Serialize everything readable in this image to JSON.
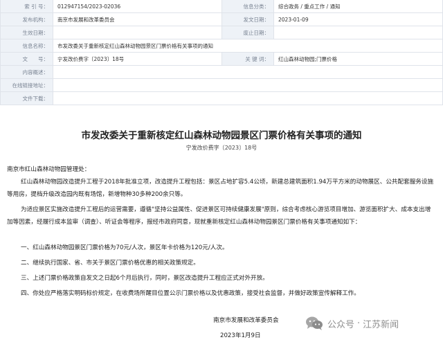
{
  "meta": {
    "rows": [
      {
        "l1": "索 引 号：",
        "v1": "012947154/2023-02036",
        "l2": "信息分类：",
        "v2": "综合政务 / 重点工作 / 通知"
      },
      {
        "l1": "发布机构：",
        "v1": "南京市发展和改革委员会",
        "l2": "发文日期：",
        "v2": "2023-01-09"
      },
      {
        "l1": "生效日期：",
        "v1": "",
        "l2": "废止日期：",
        "v2": ""
      },
      {
        "l1": "信息名称：",
        "v1": "市发改委关于重新核定红山森林动物园景区门票价格有关事项的通知"
      },
      {
        "l1": "文　　号：",
        "v1": "宁发改价费字〔2023〕18号",
        "l2": "关 键 词：",
        "v2": "红山森林动物园;门票价格"
      },
      {
        "l1": "内容概述：",
        "v1": ""
      },
      {
        "l1": "在线链接地址：",
        "v1": ""
      },
      {
        "l1": "文件下载：",
        "v1": ""
      }
    ]
  },
  "doc": {
    "title": "市发改委关于重新核定红山森林动物园景区门票价格有关事项的通知",
    "doc_number": "宁发改价费字〔2023〕18号",
    "salutation": "南京市红山森林动物园管理处：",
    "paragraphs": [
      "红山森林动物园改造提升工程于2018年批准立项，改造提升工程包括：景区占地扩容5.4公顷，新建总建筑面积1.94万平方米的动物展区、公共配套服务设施等用房，提档升级改造园内既有场馆，新增物种30多种200余只等。",
      "为适应景区实施改造提升工程后的运营需要，遵循\"坚持公益属性、促进景区可持续健康发展\"原则，综合考虑核心游览项目增加、游览面积扩大、成本支出增加等因素，经履行成本监审（调查）、听证会等程序，报经市政府同意，现就重新核定红山森林动物园景区门票价格有关事项通知如下：",
      "一、红山森林动物园景区门票价格为70元/人次，景区年卡价格为120元/人次。",
      "二、继续执行国家、省、市关于景区门票价格优惠的相关政策规定。",
      "三、上述门票价格政策自发文之日起6个月后执行，同时，景区改造提升工程应正式对外开放。",
      "四、你处应严格落实明码标价规定，在收费场所醒目位置公示门票价格以及优惠政策，接受社会监督，并做好政策宣传解释工作。"
    ],
    "signature_org": "南京市发展和改革委员会",
    "signature_date": "2023年1月9日"
  },
  "watermark": {
    "left": "公众号",
    "dot": "·",
    "right": "江苏新闻"
  }
}
